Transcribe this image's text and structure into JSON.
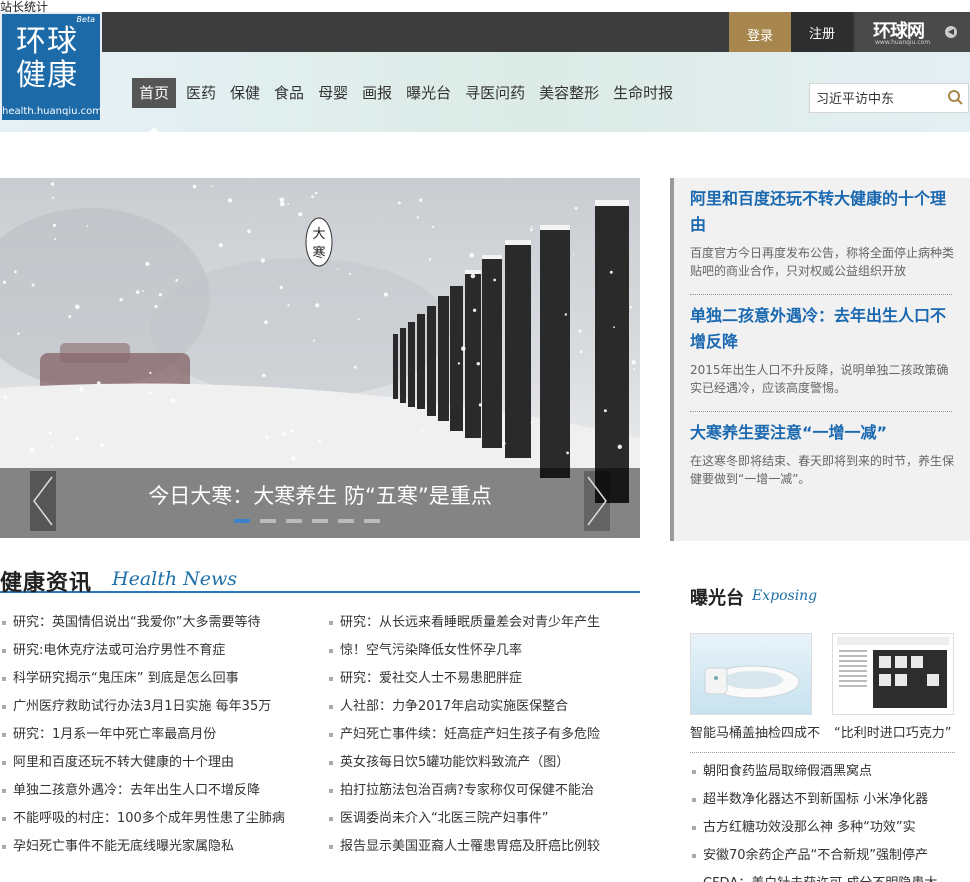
{
  "stats_text": "站长统计",
  "topbar": {
    "login": "登录",
    "register": "注册",
    "brand": "环球网",
    "brand_url": "www.huanqiu.com"
  },
  "logo": {
    "beta": "Beta",
    "line1": "环球",
    "line2": "健康",
    "url": "health.huanqiu.com"
  },
  "nav": {
    "items": [
      "首页",
      "医药",
      "保健",
      "食品",
      "母婴",
      "画报",
      "曝光台",
      "寻医问药",
      "美容整形",
      "生命时报"
    ],
    "active_index": 0
  },
  "search": {
    "value": "习近平访中东"
  },
  "hero": {
    "badge": "大寒",
    "caption": "今日大寒：大寒养生 防“五寒”是重点",
    "slide_count": 6,
    "active_slide": 0
  },
  "featured": [
    {
      "title": "阿里和百度还玩不转大健康的十个理由",
      "desc": "百度官方今日再度发布公告，称将全面停止病种类贴吧的商业合作，只对权威公益组织开放"
    },
    {
      "title": "单独二孩意外遇冷：去年出生人口不增反降",
      "desc": "2015年出生人口不升反降，说明单独二孩政策确实已经遇冷，应该高度警惕。"
    },
    {
      "title": "大寒养生要注意“一增一减”",
      "desc": "在这寒冬即将结束、春天即将到来的时节，养生保健要做到“一增一减”。"
    }
  ],
  "health_news": {
    "title": "健康资讯",
    "title_en": "Health News",
    "left": [
      "研究：英国情侣说出“我爱你”大多需要等待",
      "研究:电休克疗法或可治疗男性不育症",
      "科学研究揭示“鬼压床” 到底是怎么回事",
      "广州医疗救助试行办法3月1日实施 每年35万",
      "研究：1月系一年中死亡率最高月份",
      "阿里和百度还玩不转大健康的十个理由",
      "单独二孩意外遇冷：去年出生人口不增反降",
      "不能呼吸的村庄：100多个成年男性患了尘肺病",
      "孕妇死亡事件不能无底线曝光家属隐私"
    ],
    "right": [
      "研究：从长远来看睡眠质量差会对青少年产生",
      "惊！空气污染降低女性怀孕几率",
      "研究：爱社交人士不易患肥胖症",
      "人社部：力争2017年启动实施医保整合",
      "产妇死亡事件续：妊高症产妇生孩子有多危险",
      "英女孩每日饮5罐功能饮料致流产（图）",
      "拍打拉筋法包治百病?专家称仅可保健不能治",
      "医调委尚未介入“北医三院产妇事件”",
      "报告显示美国亚裔人士罹患胃癌及肝癌比例较"
    ]
  },
  "exposing": {
    "title": "曝光台",
    "title_en": "Exposing",
    "cards": [
      {
        "caption": "智能马桶盖抽检四成不"
      },
      {
        "caption": "“比利时进口巧克力”"
      }
    ],
    "list": [
      "朝阳食药监局取缔假酒黑窝点",
      "超半数净化器达不到新国标 小米净化器",
      "古方红糖功效没那么神 多种“功效”实",
      "安徽70余药企产品“不合新规”强制停产",
      "CFDA：美白针未获许可 成分不明隐患大"
    ]
  },
  "colors": {
    "accent_blue": "#1a68b0",
    "login_gold": "#a8874e",
    "topbar": "#3d3d3d"
  }
}
